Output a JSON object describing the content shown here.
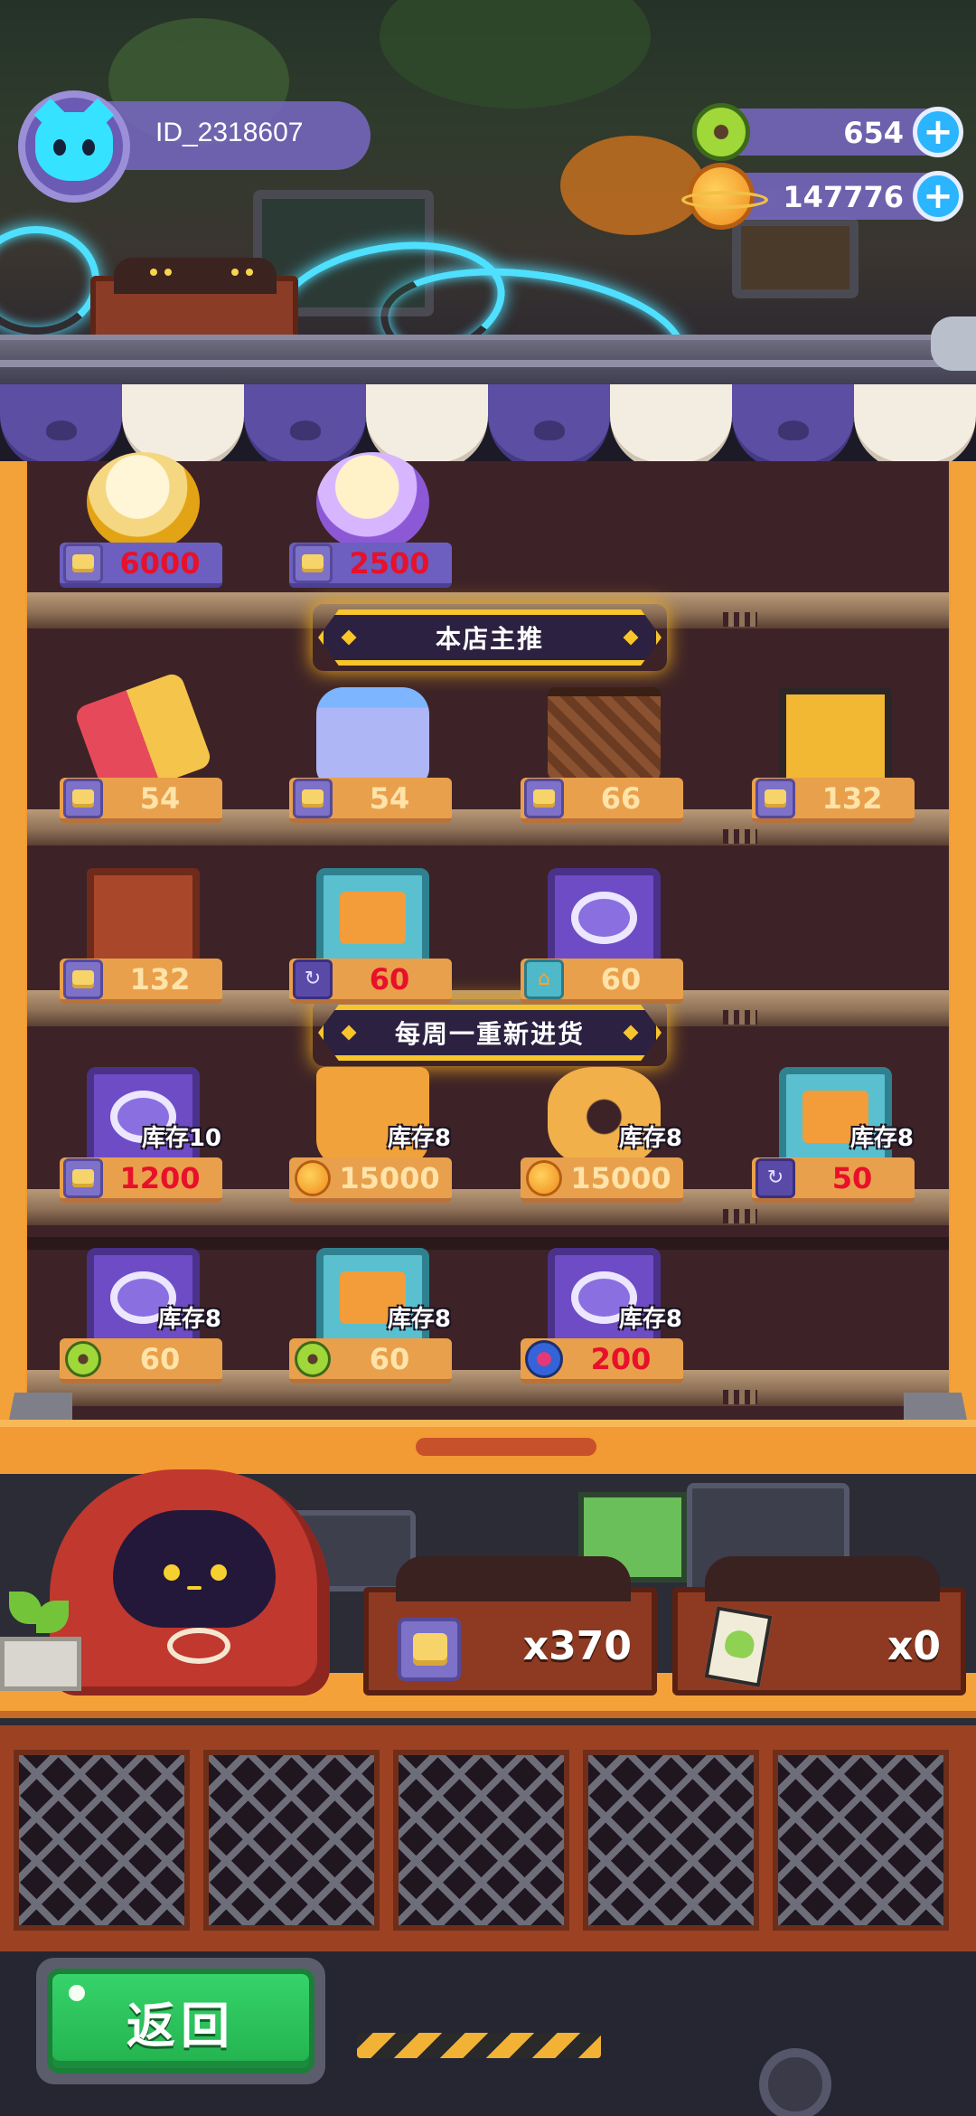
{
  "player": {
    "id": "ID_2318607",
    "avatar_icon": "cyan-cat-icon"
  },
  "currencies": [
    {
      "icon": "donut-coin-icon",
      "amount": "654"
    },
    {
      "icon": "planet-coin-icon",
      "amount": "147776"
    }
  ],
  "sections": {
    "featured_title": "本店主推",
    "weekly_title": "每周一重新进货"
  },
  "shelf_rows": [
    [
      {
        "icon": "gold-orb-icon",
        "currency": "ticket",
        "price": "6000",
        "price_red": true,
        "tag": "purple"
      },
      {
        "icon": "purple-orb-icon",
        "currency": "ticket",
        "price": "2500",
        "price_red": true,
        "tag": "purple"
      }
    ],
    [
      {
        "icon": "paint-scroll-icon",
        "currency": "ticket",
        "price": "54"
      },
      {
        "icon": "potion-bottle-icon",
        "currency": "ticket",
        "price": "54"
      },
      {
        "icon": "handbag-icon",
        "currency": "ticket",
        "price": "66"
      },
      {
        "icon": "toolbox-icon",
        "currency": "ticket",
        "price": "132"
      }
    ],
    [
      {
        "icon": "wooden-crate-icon",
        "currency": "ticket",
        "price": "132"
      },
      {
        "icon": "teal-house-card-icon",
        "currency": "swirl",
        "price": "60",
        "price_red": true
      },
      {
        "icon": "purple-swirl-card-icon",
        "currency": "house",
        "price": "60"
      }
    ],
    [
      {
        "icon": "purple-cabinet-card-icon",
        "currency": "ticket",
        "price": "1200",
        "price_red": true,
        "stock": "库存10"
      },
      {
        "icon": "golden-bolt-icon",
        "currency": "planet",
        "price": "15000",
        "stock": "库存8"
      },
      {
        "icon": "golden-nut-icon",
        "currency": "planet",
        "price": "15000",
        "stock": "库存8"
      },
      {
        "icon": "teal-house-card-icon",
        "currency": "swirl",
        "price": "50",
        "price_red": true,
        "stock": "库存8"
      }
    ],
    [
      {
        "icon": "purple-swirl-card-icon",
        "currency": "donut",
        "price": "60",
        "stock": "库存8"
      },
      {
        "icon": "teal-house-card-icon",
        "currency": "donut",
        "price": "60",
        "stock": "库存8"
      },
      {
        "icon": "purple-cabinet-card-icon",
        "currency": "badge",
        "price": "200",
        "price_red": true,
        "stock": "库存8"
      }
    ]
  ],
  "resources": [
    {
      "icon": "ticket-icon",
      "count": "x370"
    },
    {
      "icon": "seed-packet-icon",
      "count": "x0"
    }
  ],
  "back_button": {
    "label": "返回"
  },
  "colors": {
    "accent": "#f8c52b",
    "price_red": "#e8102a",
    "button_green": "#23b24e"
  }
}
